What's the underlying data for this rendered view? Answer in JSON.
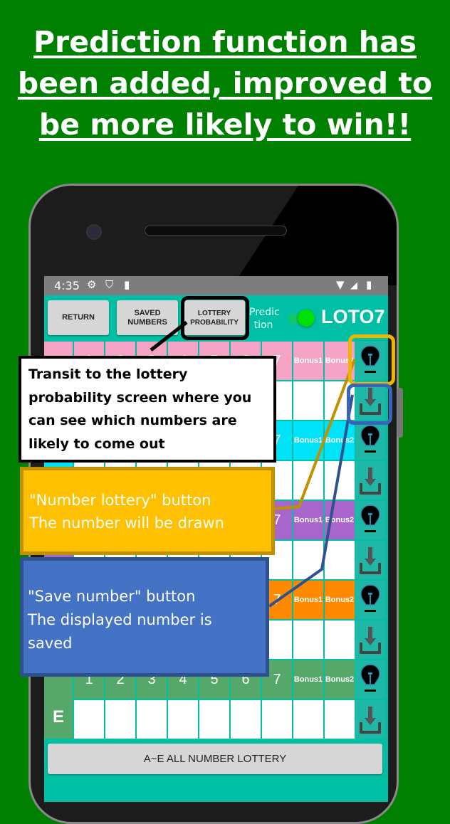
{
  "headline": [
    "Prediction function has",
    "been added, improved to",
    "be more likely to win!!"
  ],
  "status": {
    "time": "4:35"
  },
  "toolbar": {
    "return": "RETURN",
    "saved": "SAVED NUMBERS",
    "probability": "LOTTERY PROBABILITY",
    "prediction_label": "Predic tion",
    "prediction_on": true,
    "logo": "LOTO7"
  },
  "grid": {
    "headers": [
      "1",
      "2",
      "3",
      "4",
      "5",
      "6",
      "7",
      "Bonus1",
      "Bonus2"
    ],
    "rows": [
      {
        "letter": "",
        "color": "#f4a3c4"
      },
      {
        "letter": "",
        "color": "#00e2f8"
      },
      {
        "letter": "",
        "color": "#a866cc"
      },
      {
        "letter": "",
        "color": "#ff8a00"
      },
      {
        "letter": "E",
        "color": "#56a86a"
      }
    ],
    "row_icons": [
      "lightbulb-lottery-icon",
      "save-download-icon"
    ]
  },
  "all_button": "A~E ALL NUMBER LOTTERY",
  "callouts": {
    "probability": "Transit to the lottery probability screen where you can see which numbers are likely to come out",
    "lottery": [
      "\"Number lottery\" button",
      "The number will be drawn"
    ],
    "save": [
      "\"Save number\" button",
      "The displayed number is",
      "saved"
    ]
  },
  "colors": {
    "background": "#008000",
    "app": "#00bfa5",
    "lottery_callout": "#ffc000",
    "save_callout": "#4472c4"
  }
}
